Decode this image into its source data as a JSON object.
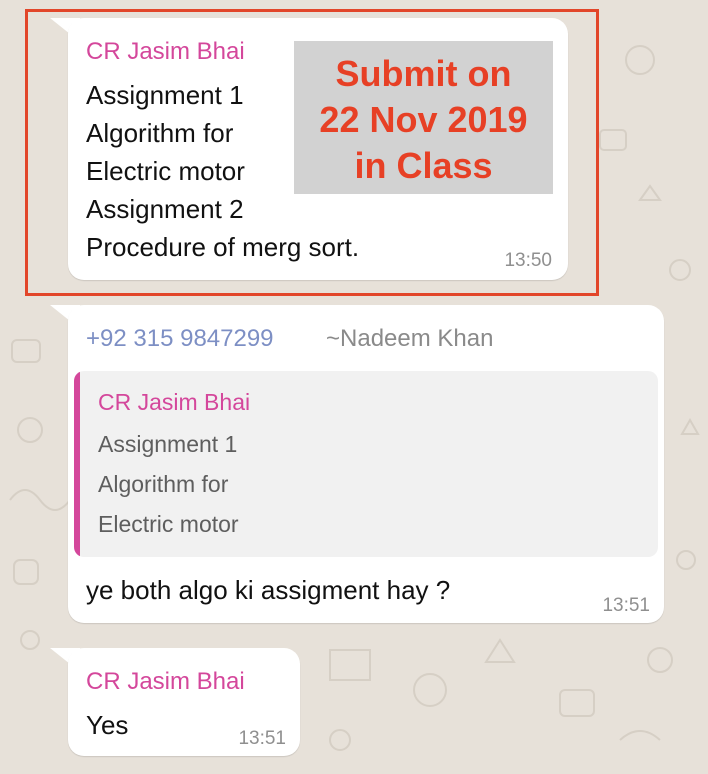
{
  "colors": {
    "chat_background": "#e7e1d9",
    "bubble": "#ffffff",
    "sender_name": "#d4479b",
    "phone_number": "#7d8fc4",
    "timestamp": "#8f8f8f",
    "annotation_text": "#e74025",
    "annotation_box": "#d2d2d2",
    "highlight_border": "#e2462a"
  },
  "messages": [
    {
      "sender": "CR Jasim Bhai",
      "lines": [
        "Assignment 1",
        "Algorithm for",
        "Electric motor",
        "Assignment 2",
        "Procedure of merg sort."
      ],
      "time": "13:50"
    },
    {
      "phone": "+92 315 9847299",
      "alias": "~Nadeem Khan",
      "quoted": {
        "sender": "CR Jasim Bhai",
        "lines": [
          "Assignment 1",
          "Algorithm for",
          "Electric motor"
        ]
      },
      "text": "ye both algo ki assigment hay ?",
      "time": "13:51"
    },
    {
      "sender": "CR Jasim Bhai",
      "text": "Yes",
      "time": "13:51"
    }
  ],
  "annotation": {
    "lines": [
      "Submit on",
      "22 Nov 2019",
      "in Class"
    ]
  }
}
